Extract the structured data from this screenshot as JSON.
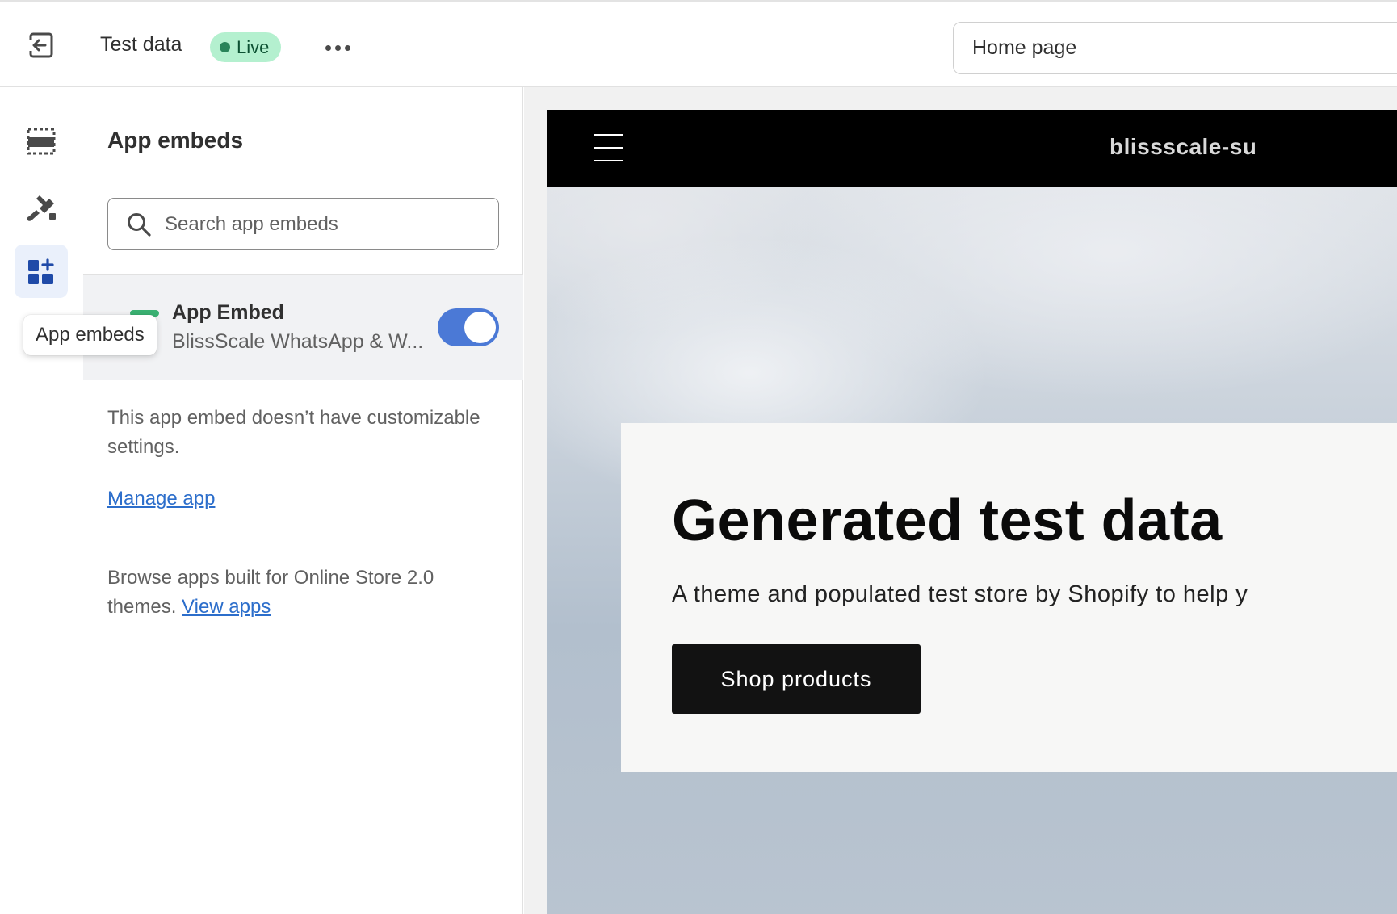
{
  "topbar": {
    "theme_name": "Test data",
    "status_badge": "Live",
    "page_select_value": "Home page"
  },
  "rail": {
    "items": [
      {
        "icon": "sections-icon",
        "active": false
      },
      {
        "icon": "theme-settings-brush-icon",
        "active": false
      },
      {
        "icon": "app-embeds-icon",
        "active": true
      }
    ],
    "tooltip": "App embeds"
  },
  "panel": {
    "title": "App embeds",
    "search_placeholder": "Search app embeds",
    "embed": {
      "title": "App Embed",
      "subtitle": "BlissScale WhatsApp & W...",
      "enabled": true
    },
    "info_text": "This app embed doesn’t have customizable settings.",
    "manage_link": "Manage app",
    "browse_text": "Browse apps built for Online Store 2.0 themes.",
    "view_apps_link": "View apps"
  },
  "preview": {
    "store_name": "blissscale-su",
    "hero_title": "Generated test data",
    "hero_subtitle": "A theme and populated test store by Shopify to help y",
    "cta_label": "Shop products"
  },
  "colors": {
    "accent": "#4b79d6",
    "link": "#2c6ecb",
    "live_badge_bg": "#b4f0cf",
    "live_dot": "#29845a",
    "rail_active_bg": "#eaf0fb"
  }
}
